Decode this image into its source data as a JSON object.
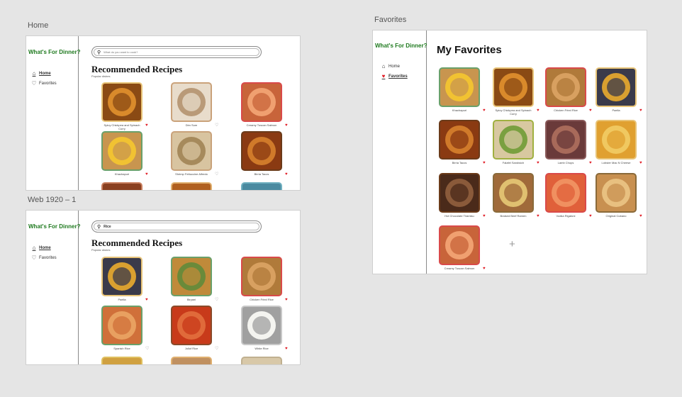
{
  "labels": {
    "home": "Home",
    "web": "Web 1920 – 1",
    "favorites": "Favorites"
  },
  "brand": "What's For Dinner?",
  "nav": {
    "home": "Home",
    "favorites": "Favorites"
  },
  "home_board": {
    "search_placeholder": "What do you want to cook?",
    "title": "Recommended Recipes",
    "subtitle": "Popular dishes",
    "cards": [
      {
        "name": "Spicy Chickpea and Spinach Curry",
        "fav": true,
        "border": "#e8c478",
        "food": "#8a4a14",
        "food2": "#d98a2b"
      },
      {
        "name": "Dim Sum",
        "fav": false,
        "border": "#caa27a",
        "food": "#e8dccb",
        "food2": "#b99a78"
      },
      {
        "name": "Creamy Tuscan Salmon",
        "fav": true,
        "border": "#d94a4a",
        "food": "#c8643a",
        "food2": "#f0a070"
      },
      {
        "name": "Khachapuri",
        "fav": true,
        "border": "#6aa06a",
        "food": "#c8954f",
        "food2": "#f1c232"
      },
      {
        "name": "Shrimp Fettuccine Alfredo",
        "fav": false,
        "border": "#c9a27a",
        "food": "#d8c4a0",
        "food2": "#a68a5c"
      },
      {
        "name": "Birria Tacos",
        "fav": true,
        "border": "#6b3b1a",
        "food": "#8a3a12",
        "food2": "#d07a2a"
      }
    ],
    "peek": [
      {
        "border": "#c98060",
        "food": "#8a4020"
      },
      {
        "border": "#e0b070",
        "food": "#b06020"
      },
      {
        "border": "#70b0c0",
        "food": "#4a8aa0"
      }
    ]
  },
  "web_board": {
    "search_value": "Rice",
    "title": "Recommended Recipes",
    "subtitle": "Popular dishes",
    "cards": [
      {
        "name": "Paella",
        "fav": true,
        "border": "#e8c478",
        "food": "#3a3a4a",
        "food2": "#d9a030"
      },
      {
        "name": "Biryani",
        "fav": false,
        "border": "#6aa06a",
        "food": "#c08a3a",
        "food2": "#6a8a3a"
      },
      {
        "name": "Chicken Fried Rice",
        "fav": true,
        "border": "#d94a4a",
        "food": "#b07a3a",
        "food2": "#d8a060"
      },
      {
        "name": "Spanish Rice",
        "fav": false,
        "border": "#6aa06a",
        "food": "#d0703a",
        "food2": "#e8a060"
      },
      {
        "name": "Jollof Rice",
        "fav": false,
        "border": "#8a4a2a",
        "food": "#c83a1a",
        "food2": "#e06a3a"
      },
      {
        "name": "White Rice",
        "fav": true,
        "border": "#c8c8c8",
        "food": "#a0a0a0",
        "food2": "#f4f4f0"
      }
    ],
    "peek": [
      {
        "border": "#e0c060",
        "food": "#d0a040"
      },
      {
        "border": "#e0b070",
        "food": "#c09060"
      },
      {
        "border": "#c0b090",
        "food": "#d8c8a8"
      }
    ]
  },
  "fav_board": {
    "title": "My Favorites",
    "cards": [
      {
        "name": "Khachapuri",
        "border": "#6aa06a",
        "food": "#c8954f",
        "food2": "#f1c232"
      },
      {
        "name": "Spicy Chickpea and Spinach Curry",
        "border": "#e8c478",
        "food": "#8a4a14",
        "food2": "#d98a2b"
      },
      {
        "name": "Chicken Fried Rice",
        "border": "#d94a4a",
        "food": "#b07a3a",
        "food2": "#d8a060"
      },
      {
        "name": "Paella",
        "border": "#e8c478",
        "food": "#3a3a4a",
        "food2": "#d9a030"
      },
      {
        "name": "Birria Tacos",
        "border": "#6b3b1a",
        "food": "#8a3a12",
        "food2": "#d07a2a"
      },
      {
        "name": "Falafel Sandwich",
        "border": "#a0b040",
        "food": "#d8c8a0",
        "food2": "#7aa040"
      },
      {
        "name": "Lamb Chops",
        "border": "#8a5a5a",
        "food": "#6a3a3a",
        "food2": "#a86a5a"
      },
      {
        "name": "Lobster Mac N Cheese",
        "border": "#e8c478",
        "food": "#e0a030",
        "food2": "#f0c860"
      },
      {
        "name": "Hot Chocolate Tiramisu",
        "border": "#6b3b1a",
        "food": "#4a2a1a",
        "food2": "#8a5a3a"
      },
      {
        "name": "Braised Beef Ramen",
        "border": "#8a6a3a",
        "food": "#a06a3a",
        "food2": "#e0c070"
      },
      {
        "name": "Vodka Rigatoni",
        "border": "#d94a4a",
        "food": "#e0603a",
        "food2": "#f09060"
      },
      {
        "name": "Original Cubano",
        "border": "#8a6a3a",
        "food": "#c89050",
        "food2": "#e8c080"
      },
      {
        "name": "Creamy Tuscan Salmon",
        "border": "#d94a4a",
        "food": "#c8643a",
        "food2": "#f0a070"
      }
    ],
    "add_label": "+"
  }
}
